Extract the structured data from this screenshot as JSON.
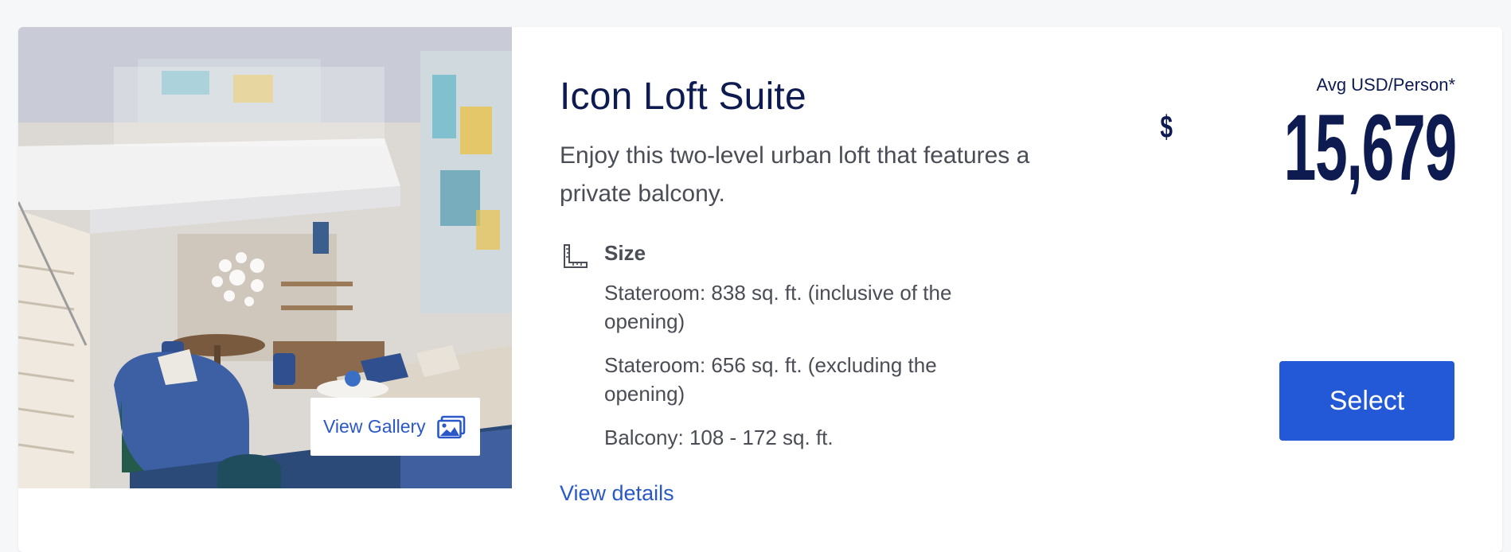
{
  "suite": {
    "title": "Icon Loft Suite",
    "description": "Enjoy this two-level urban loft that features a private balcony.",
    "gallery_label": "View Gallery",
    "size_heading": "Size",
    "size_items": [
      "Stateroom: 838 sq. ft. (inclusive of the opening)",
      "Stateroom: 656 sq. ft. (excluding the opening)",
      "Balcony: 108 - 172 sq. ft."
    ],
    "view_details_label": "View details"
  },
  "price": {
    "label": "Avg USD/Person*",
    "currency": "$",
    "amount": "15,679"
  },
  "select_label": "Select",
  "icons": {
    "gallery": "image-gallery-icon",
    "size": "ruler-corner-icon"
  },
  "colors": {
    "navy": "#0e1b50",
    "link": "#2a58c8",
    "button": "#2358d6",
    "body_text": "#4a4d55"
  }
}
